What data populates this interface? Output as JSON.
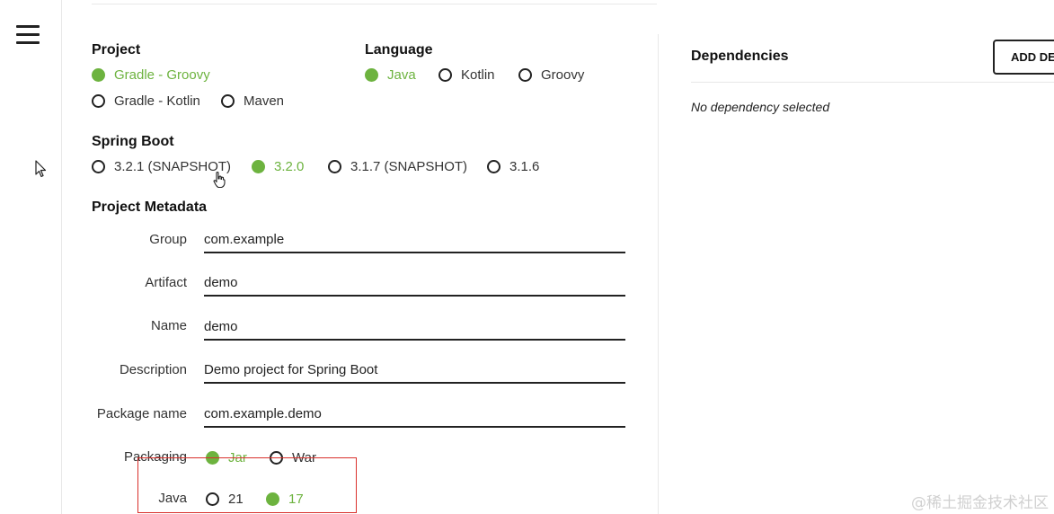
{
  "project": {
    "title": "Project",
    "options": [
      {
        "label": "Gradle - Groovy",
        "checked": true
      },
      {
        "label": "Gradle - Kotlin",
        "checked": false
      },
      {
        "label": "Maven",
        "checked": false
      }
    ]
  },
  "language": {
    "title": "Language",
    "options": [
      {
        "label": "Java",
        "checked": true
      },
      {
        "label": "Kotlin",
        "checked": false
      },
      {
        "label": "Groovy",
        "checked": false
      }
    ]
  },
  "spring_boot": {
    "title": "Spring Boot",
    "options": [
      {
        "label": "3.2.1 (SNAPSHOT)",
        "checked": false
      },
      {
        "label": "3.2.0",
        "checked": true
      },
      {
        "label": "3.1.7 (SNAPSHOT)",
        "checked": false
      },
      {
        "label": "3.1.6",
        "checked": false
      }
    ]
  },
  "metadata": {
    "title": "Project Metadata",
    "fields": [
      {
        "label": "Group",
        "value": "com.example"
      },
      {
        "label": "Artifact",
        "value": "demo"
      },
      {
        "label": "Name",
        "value": "demo"
      },
      {
        "label": "Description",
        "value": "Demo project for Spring Boot"
      },
      {
        "label": "Package name",
        "value": "com.example.demo"
      }
    ],
    "packaging": {
      "label": "Packaging",
      "options": [
        {
          "label": "Jar",
          "checked": true
        },
        {
          "label": "War",
          "checked": false
        }
      ]
    },
    "java": {
      "label": "Java",
      "options": [
        {
          "label": "21",
          "checked": false
        },
        {
          "label": "17",
          "checked": true
        }
      ]
    }
  },
  "dependencies": {
    "title": "Dependencies",
    "add_button": "ADD DE",
    "empty_text": "No dependency selected"
  },
  "watermark": "@稀土掘金技术社区",
  "colors": {
    "accent": "#6db33f",
    "highlight_box": "#d9302c"
  },
  "icons": {
    "menu": "hamburger-menu-icon",
    "cursor_arrow": "arrow-cursor-icon",
    "cursor_hand": "hand-cursor-icon"
  }
}
